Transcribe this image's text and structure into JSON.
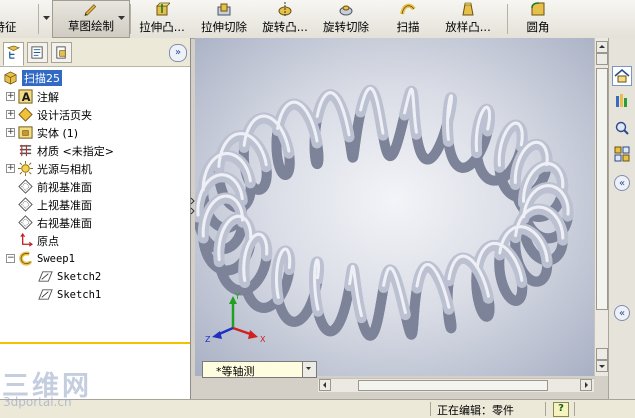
{
  "toolbar": {
    "items": [
      {
        "label": "特征"
      },
      {
        "label": "草图绘制"
      },
      {
        "label": "拉伸凸..."
      },
      {
        "label": "拉伸切除"
      },
      {
        "label": "旋转凸..."
      },
      {
        "label": "旋转切除"
      },
      {
        "label": "扫描"
      },
      {
        "label": "放样凸..."
      },
      {
        "label": "圆角"
      }
    ]
  },
  "feature_tree": {
    "root": "扫描25",
    "items": [
      {
        "label": "注解",
        "icon": "annotation-icon"
      },
      {
        "label": "设计活页夹",
        "icon": "design-binder-icon"
      },
      {
        "label": "实体 (1)",
        "icon": "solid-body-icon"
      },
      {
        "label": "材质 <未指定>",
        "icon": "material-icon"
      },
      {
        "label": "光源与相机",
        "icon": "lights-cameras-icon"
      },
      {
        "label": "前视基准面",
        "icon": "plane-icon"
      },
      {
        "label": "上视基准面",
        "icon": "plane-icon"
      },
      {
        "label": "右视基准面",
        "icon": "plane-icon"
      },
      {
        "label": "原点",
        "icon": "origin-icon"
      },
      {
        "label": "Sweep1",
        "icon": "sweep-feature-icon"
      },
      {
        "label": "Sketch2",
        "icon": "sketch-icon"
      },
      {
        "label": "Sketch1",
        "icon": "sketch-icon"
      }
    ]
  },
  "viewport": {
    "view_orientation": "*等轴测",
    "triad": {
      "x": "X",
      "y": "Y",
      "z": "Z"
    }
  },
  "statusbar": {
    "text": "正在编辑：零件",
    "help": "?"
  },
  "watermark": {
    "main": "三维网",
    "sub": "3dportal.cn"
  },
  "colors": {
    "selection": "#316ac5",
    "highlight_line": "#f2c400",
    "coil": "#aeb3c6"
  }
}
